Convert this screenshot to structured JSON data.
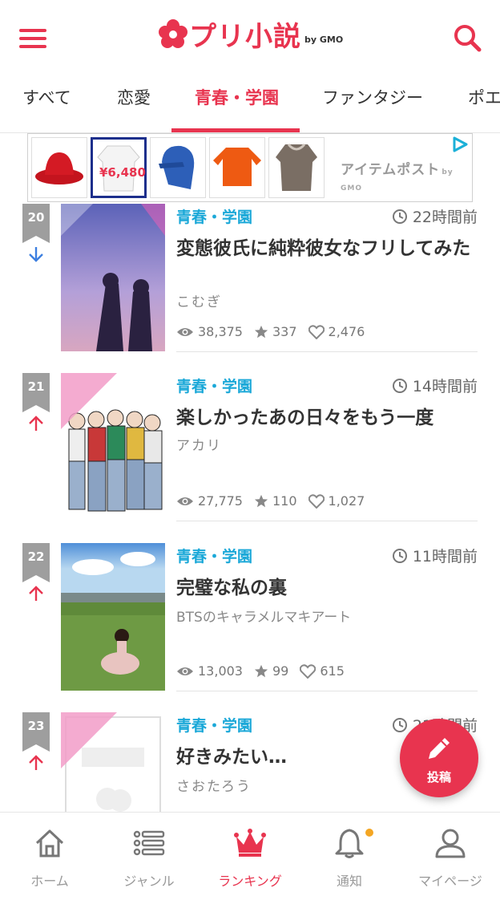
{
  "app": {
    "logo_text": "プリ小説",
    "logo_suffix": "by GMO"
  },
  "tabs": [
    {
      "label": "すべて"
    },
    {
      "label": "恋愛"
    },
    {
      "label": "青春・学園",
      "active": true
    },
    {
      "label": "ファンタジー"
    },
    {
      "label": "ポエ"
    }
  ],
  "ad": {
    "price_label": "¥6,480",
    "brand": "アイテムポスト",
    "brand_suffix": "by GMO"
  },
  "items": [
    {
      "rank": "20",
      "trend": "down",
      "genre": "青春・学園",
      "time": "22時間前",
      "title": "変態彼氏に純粋彼女なフリしてみた",
      "author": "こむぎ",
      "views": "38,375",
      "stars": "337",
      "likes": "2,476"
    },
    {
      "rank": "21",
      "trend": "up",
      "genre": "青春・学園",
      "time": "14時間前",
      "title": "楽しかったあの日々をもう一度",
      "author": "アカリ",
      "views": "27,775",
      "stars": "110",
      "likes": "1,027"
    },
    {
      "rank": "22",
      "trend": "up",
      "genre": "青春・学園",
      "time": "11時間前",
      "title": "完璧な私の裏",
      "author": "BTSのキャラメルマキアート",
      "views": "13,003",
      "stars": "99",
      "likes": "615"
    },
    {
      "rank": "23",
      "trend": "up",
      "genre": "青春・学園",
      "time": "21時間前",
      "title": "好きみたい…",
      "author": "さおたろう"
    }
  ],
  "fab": {
    "label": "投稿"
  },
  "nav": [
    {
      "label": "ホーム",
      "icon": "home-icon"
    },
    {
      "label": "ジャンル",
      "icon": "list-icon"
    },
    {
      "label": "ランキング",
      "icon": "crown-icon",
      "active": true
    },
    {
      "label": "通知",
      "icon": "bell-icon",
      "badge": true
    },
    {
      "label": "マイページ",
      "icon": "user-icon"
    }
  ],
  "colors": {
    "accent": "#e8344f",
    "genre": "#1ba8d8",
    "trend_up": "#e8344f",
    "trend_down": "#3d7fe0"
  }
}
